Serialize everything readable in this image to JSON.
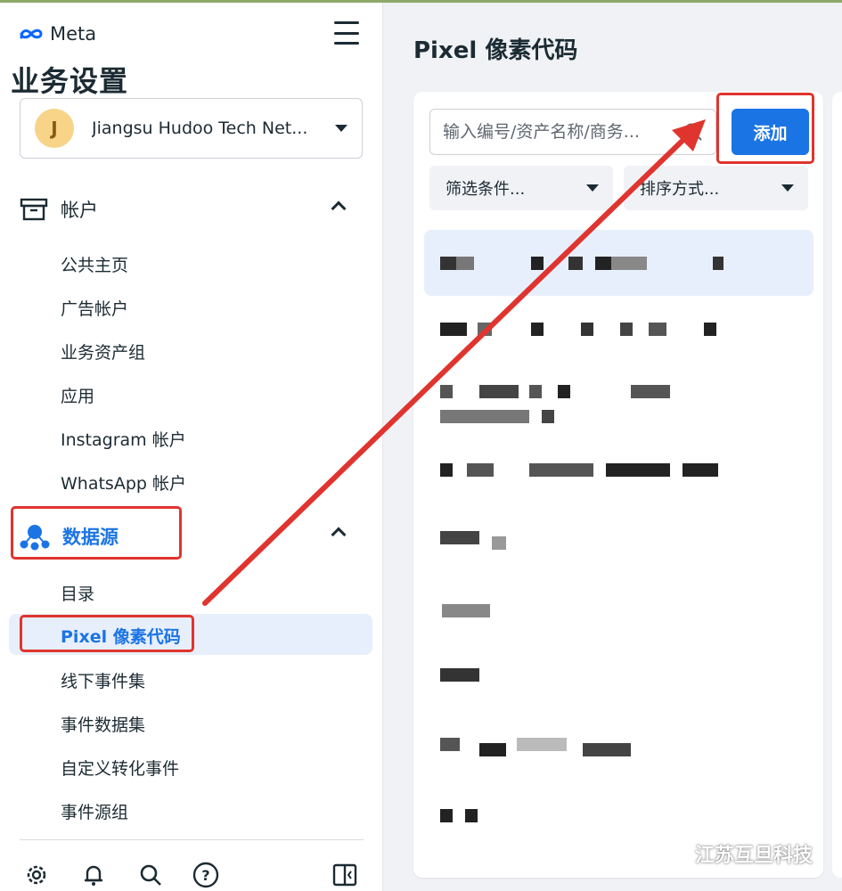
{
  "brand": {
    "logo_text": "Meta"
  },
  "sidebar": {
    "title": "业务设置",
    "account": {
      "avatar_letter": "J",
      "name": "Jiangsu Hudoo Tech Net..."
    },
    "accounts_section": {
      "label": "帐户",
      "items": [
        "公共主页",
        "广告帐户",
        "业务资产组",
        "应用",
        "Instagram 帐户",
        "WhatsApp 帐户"
      ]
    },
    "datasources_section": {
      "label": "数据源",
      "items": [
        "目录",
        "Pixel 像素代码",
        "线下事件集",
        "事件数据集",
        "自定义转化事件",
        "事件源组"
      ],
      "active_index": 1
    },
    "footer_icons": [
      "settings-icon",
      "bell-icon",
      "search-icon",
      "help-icon",
      "panel-toggle-icon"
    ]
  },
  "main": {
    "title": "Pixel 像素代码",
    "search": {
      "placeholder": "输入编号/资产名称/商务..."
    },
    "add_button": "添加",
    "filter_label": "筛选条件...",
    "sort_label": "排序方式..."
  },
  "watermark": {
    "text": "江苏互旦科技"
  },
  "colors": {
    "accent": "#1b74e4",
    "annotation_red": "#e0342f",
    "active_bg": "#e7effc"
  }
}
